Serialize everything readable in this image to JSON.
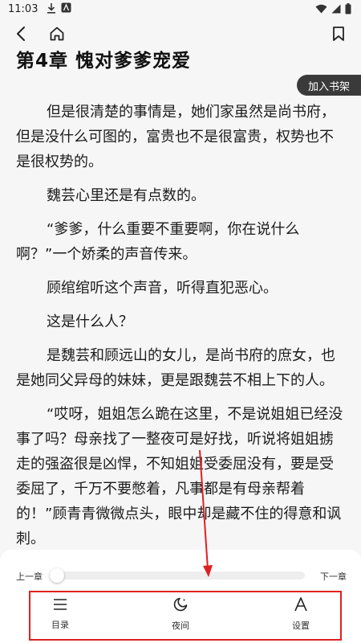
{
  "status_bar": {
    "time": "11:03"
  },
  "toolbar_top": {
    "add_to_shelf": "加入书架"
  },
  "chapter": {
    "title": "第4章 愧对爹爹宠爱",
    "paragraphs": [
      "但是很清楚的事情是，她们家虽然是尚书府，但是没什么可图的，富贵也不是很富贵，权势也不是很权势的。",
      "魏芸心里还是有点数的。",
      "“爹爹，什么重要不重要啊，你在说什么啊？”一个娇柔的声音传来。",
      "顾绾绾听这个声音，听得直犯恶心。",
      "这是什么人？",
      "是魏芸和顾远山的女儿，是尚书府的庶女，也是她同父异母的妹妹，更是跟魏芸不相上下的人。",
      "“哎呀，姐姐怎么跪在这里，不是说姐姐已经没事了吗？母亲找了一整夜可是好找，听说将姐姐掳走的强盗很是凶悍，不知姐姐受委屈没有，要是受委屈了，千万不要憋着，凡事都是有母亲帮着的！”顾青青微微点头，眼中却是藏不住的得意和讽刺。"
    ]
  },
  "reader_controls": {
    "prev_chapter": "上一章",
    "next_chapter": "下一章",
    "progress": 0,
    "toc_label": "目录",
    "night_label": "夜间",
    "settings_label": "设置"
  },
  "colors": {
    "annotation": "#e02020",
    "shelf_button": "#3a3a3a"
  },
  "icons": [
    "download-icon",
    "app-icon",
    "wifi-icon",
    "signal-icon",
    "battery-icon",
    "back-icon",
    "home-icon",
    "bookmark-icon",
    "list-icon",
    "moon-icon",
    "font-icon"
  ]
}
